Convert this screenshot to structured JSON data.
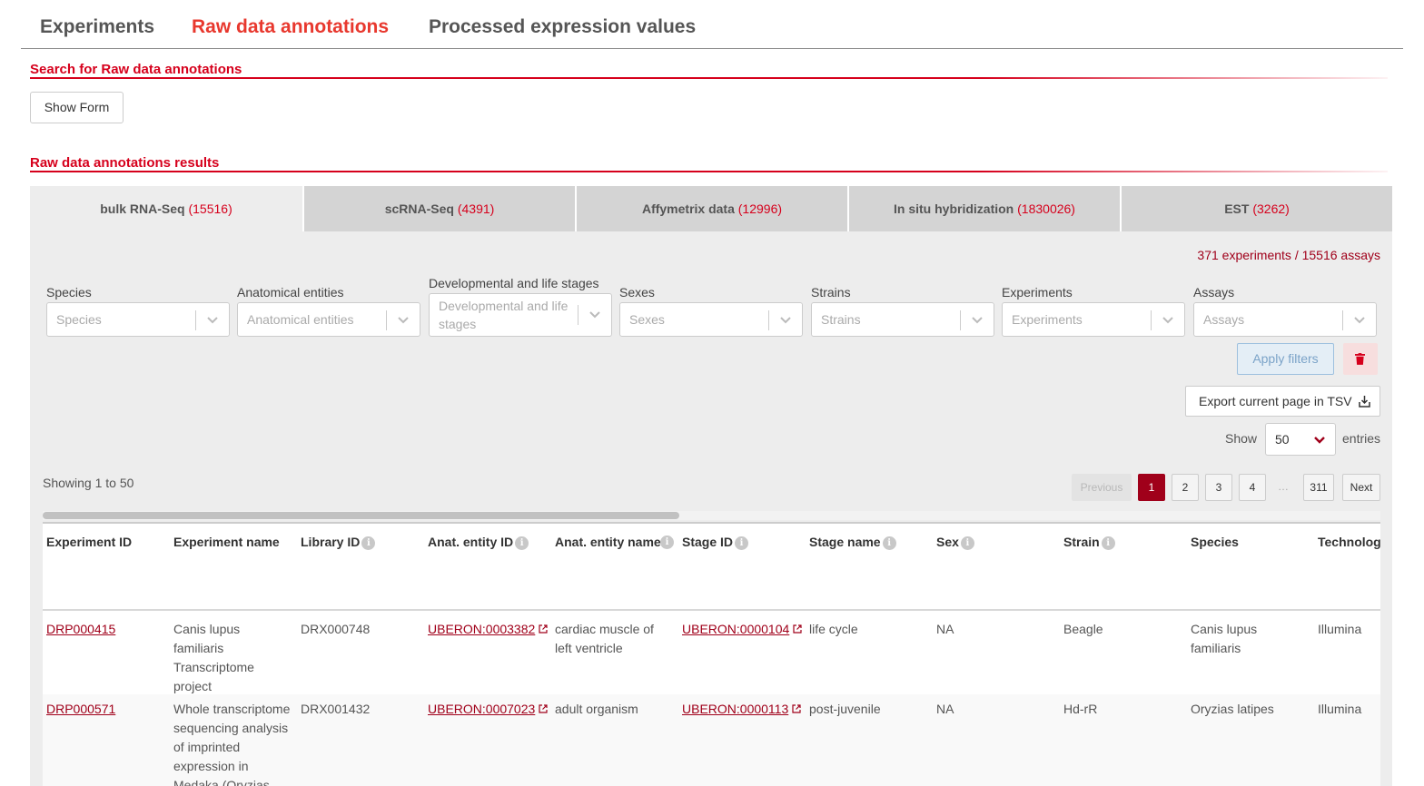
{
  "top_tabs": [
    {
      "label": "Experiments"
    },
    {
      "label": "Raw data annotations"
    },
    {
      "label": "Processed expression values"
    }
  ],
  "search_section": {
    "title": "Search for Raw data annotations",
    "show_form_label": "Show Form"
  },
  "results_section": {
    "title": "Raw data annotations results"
  },
  "data_tabs": [
    {
      "label": "bulk RNA-Seq",
      "count": "(15516)"
    },
    {
      "label": "scRNA-Seq",
      "count": "(4391)"
    },
    {
      "label": "Affymetrix data",
      "count": "(12996)"
    },
    {
      "label": "In situ hybridization",
      "count": "(1830026)"
    },
    {
      "label": "EST",
      "count": "(3262)"
    }
  ],
  "summary": "371 experiments / 15516 assays",
  "filters": [
    {
      "label": "Species",
      "placeholder": "Species"
    },
    {
      "label": "Anatomical entities",
      "placeholder": "Anatomical entities"
    },
    {
      "label": "Developmental and life stages",
      "placeholder": "Developmental and life stages"
    },
    {
      "label": "Sexes",
      "placeholder": "Sexes"
    },
    {
      "label": "Strains",
      "placeholder": "Strains"
    },
    {
      "label": "Experiments",
      "placeholder": "Experiments"
    },
    {
      "label": "Assays",
      "placeholder": "Assays"
    }
  ],
  "actions": {
    "apply_label": "Apply filters",
    "export_label": "Export current page in TSV"
  },
  "entries": {
    "show_label": "Show",
    "value": "50",
    "suffix": "entries"
  },
  "showing_text": "Showing 1 to 50",
  "pagination": {
    "previous": "Previous",
    "pages": [
      "1",
      "2",
      "3",
      "4"
    ],
    "ellipsis": "…",
    "last": "311",
    "next": "Next",
    "current": "1"
  },
  "table": {
    "columns": [
      "Experiment ID",
      "Experiment name",
      "Library ID",
      "Anat. entity ID",
      "Anat. entity name",
      "Stage ID",
      "Stage name",
      "Sex",
      "Strain",
      "Species",
      "Technolog"
    ],
    "rows": [
      {
        "experiment_id": "DRP000415",
        "experiment_name": "Canis lupus familiaris Transcriptome project",
        "library_id": "DRX000748",
        "anat_entity_id": "UBERON:0003382",
        "anat_entity_name": "cardiac muscle of left ventricle",
        "stage_id": "UBERON:0000104",
        "stage_name": "life cycle",
        "sex": "NA",
        "strain": "Beagle",
        "species": "Canis lupus familiaris",
        "technology": "Illumina"
      },
      {
        "experiment_id": "DRP000571",
        "experiment_name": "Whole transcriptome sequencing analysis of imprinted expression in Medaka (Oryzias",
        "library_id": "DRX001432",
        "anat_entity_id": "UBERON:0007023",
        "anat_entity_name": "adult organism",
        "stage_id": "UBERON:0000113",
        "stage_name": "post-juvenile",
        "sex": "NA",
        "strain": "Hd-rR",
        "species": "Oryzias latipes",
        "technology": "Illumina"
      }
    ]
  },
  "colors": {
    "accent": "#e8382e",
    "brand_red": "#d6001c",
    "dark_red": "#a0001a",
    "panel_bg": "#ededed"
  }
}
